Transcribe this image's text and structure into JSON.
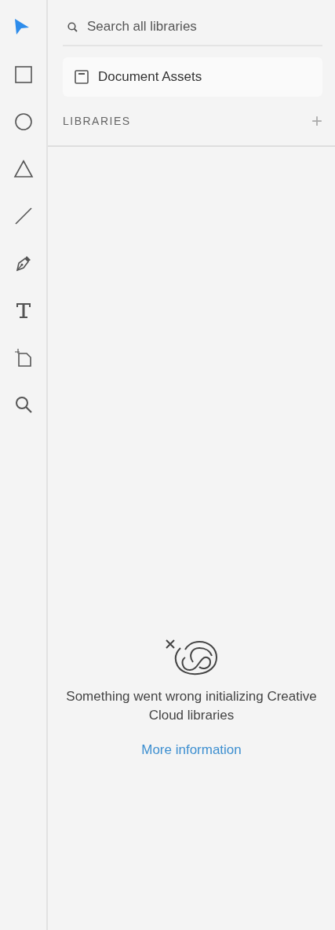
{
  "toolbar": {
    "tools": [
      {
        "kind": "select",
        "selected": true
      },
      {
        "kind": "rectangle",
        "selected": false
      },
      {
        "kind": "ellipse",
        "selected": false
      },
      {
        "kind": "triangle",
        "selected": false
      },
      {
        "kind": "line",
        "selected": false
      },
      {
        "kind": "pen",
        "selected": false
      },
      {
        "kind": "text",
        "selected": false
      },
      {
        "kind": "artboard",
        "selected": false
      },
      {
        "kind": "zoom",
        "selected": false
      }
    ]
  },
  "panel": {
    "search": {
      "placeholder": "Search all libraries"
    },
    "document_assets": {
      "label": "Document Assets"
    },
    "libraries_header": {
      "title": "LIBRARIES",
      "add": "+"
    },
    "error": {
      "message": "Something went wrong initializing Creative Cloud libraries",
      "link": "More information"
    }
  }
}
